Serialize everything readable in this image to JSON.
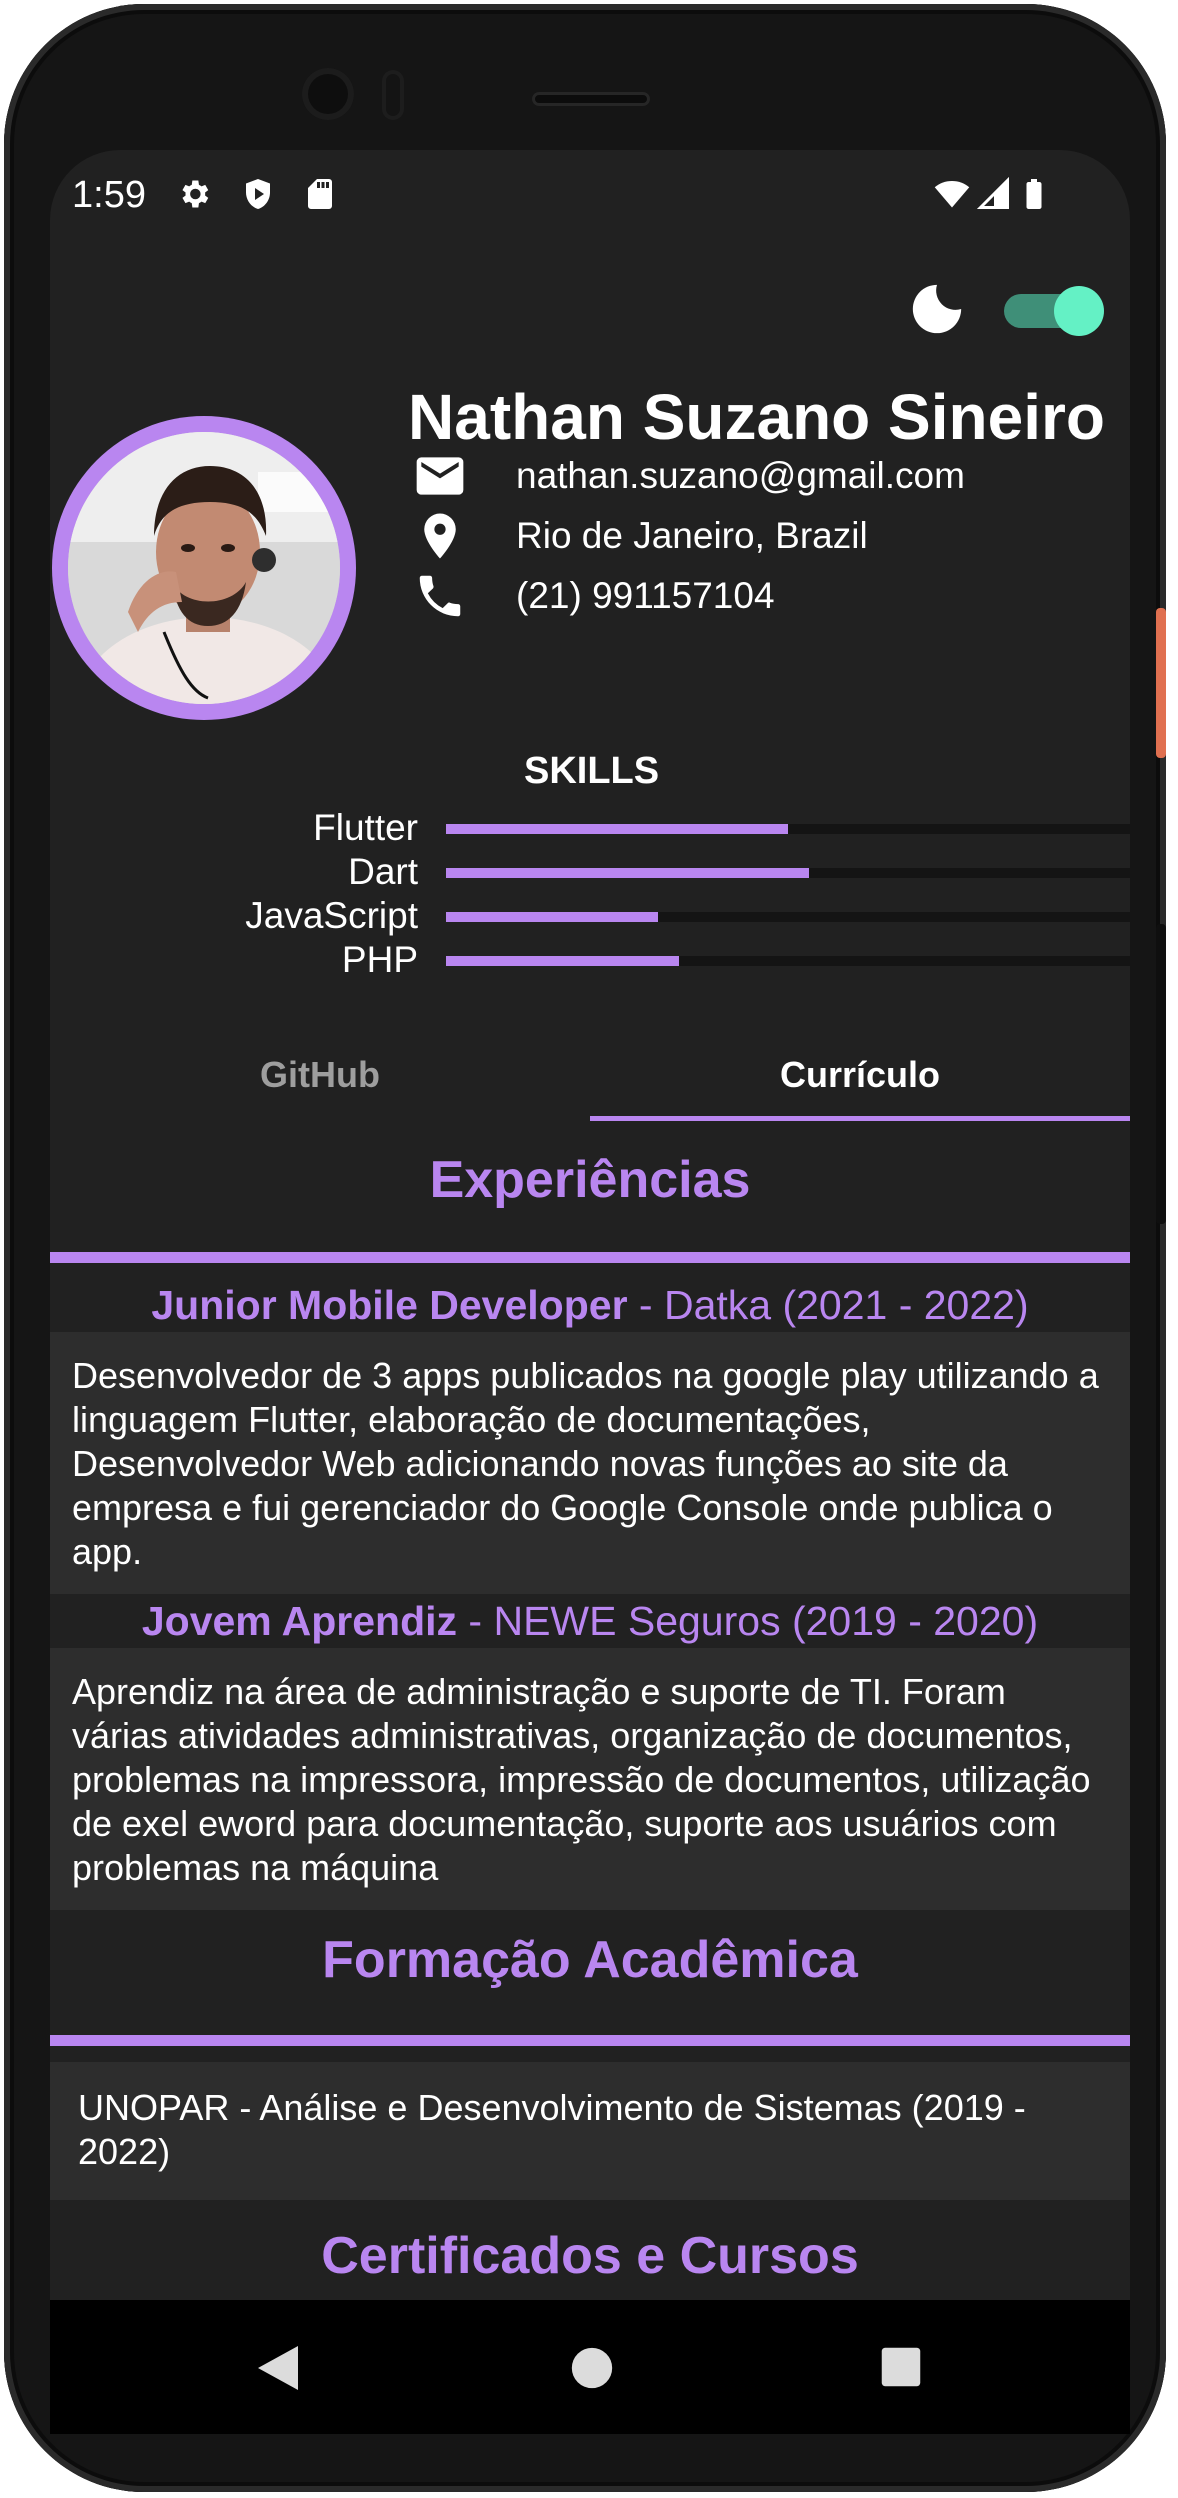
{
  "status_bar": {
    "time": "1:59",
    "left_icons": [
      "gear-icon",
      "shield-icon",
      "sd-card-icon"
    ],
    "right_icons": [
      "wifi-icon",
      "signal-icon",
      "battery-icon"
    ]
  },
  "header": {
    "theme_icon": "moon-icon",
    "dark_mode_toggle_on": true,
    "accent_color": "#b986f0",
    "toggle_color": "#64f1c5"
  },
  "profile": {
    "name": "Nathan Suzano Sineiro",
    "email": "nathan.suzano@gmail.com",
    "location": "Rio de Janeiro, Brazil",
    "phone": "(21) 991157104"
  },
  "skills": {
    "title": "SKILLS",
    "items": [
      {
        "label": "Flutter",
        "level": 0.5
      },
      {
        "label": "Dart",
        "level": 0.53
      },
      {
        "label": "JavaScript",
        "level": 0.31
      },
      {
        "label": "PHP",
        "level": 0.34
      }
    ]
  },
  "tabs": [
    {
      "label": "GitHub",
      "selected": false
    },
    {
      "label": "Currículo",
      "selected": true
    }
  ],
  "experiences": {
    "title": "Experiências",
    "items": [
      {
        "role": "Junior Mobile Developer ",
        "company": " - Datka (2021 - 2022)",
        "description": "Desenvolvedor de 3 apps publicados na google play utilizando a linguagem Flutter, elaboração de documentações, Desenvolvedor Web adicionando novas funções ao site da empresa e fui gerenciador do Google Console onde publica o app."
      },
      {
        "role": "Jovem Aprendiz",
        "company": " - NEWE Seguros (2019 - 2020)",
        "description": "Aprendiz na área de administração e suporte de TI. Foram várias atividades administrativas, organização de documentos, problemas na impressora, impressão de documentos, utilização de exel eword para documentação, suporte aos usuários com problemas na máquina"
      }
    ]
  },
  "education": {
    "title": "Formação Acadêmica",
    "items": [
      "UNOPAR - Análise e Desenvolvimento de Sistemas (2019 - 2022)"
    ]
  },
  "certificates": {
    "title": "Certificados e Cursos"
  },
  "nav_bar": [
    "back-icon",
    "home-icon",
    "recents-icon"
  ]
}
